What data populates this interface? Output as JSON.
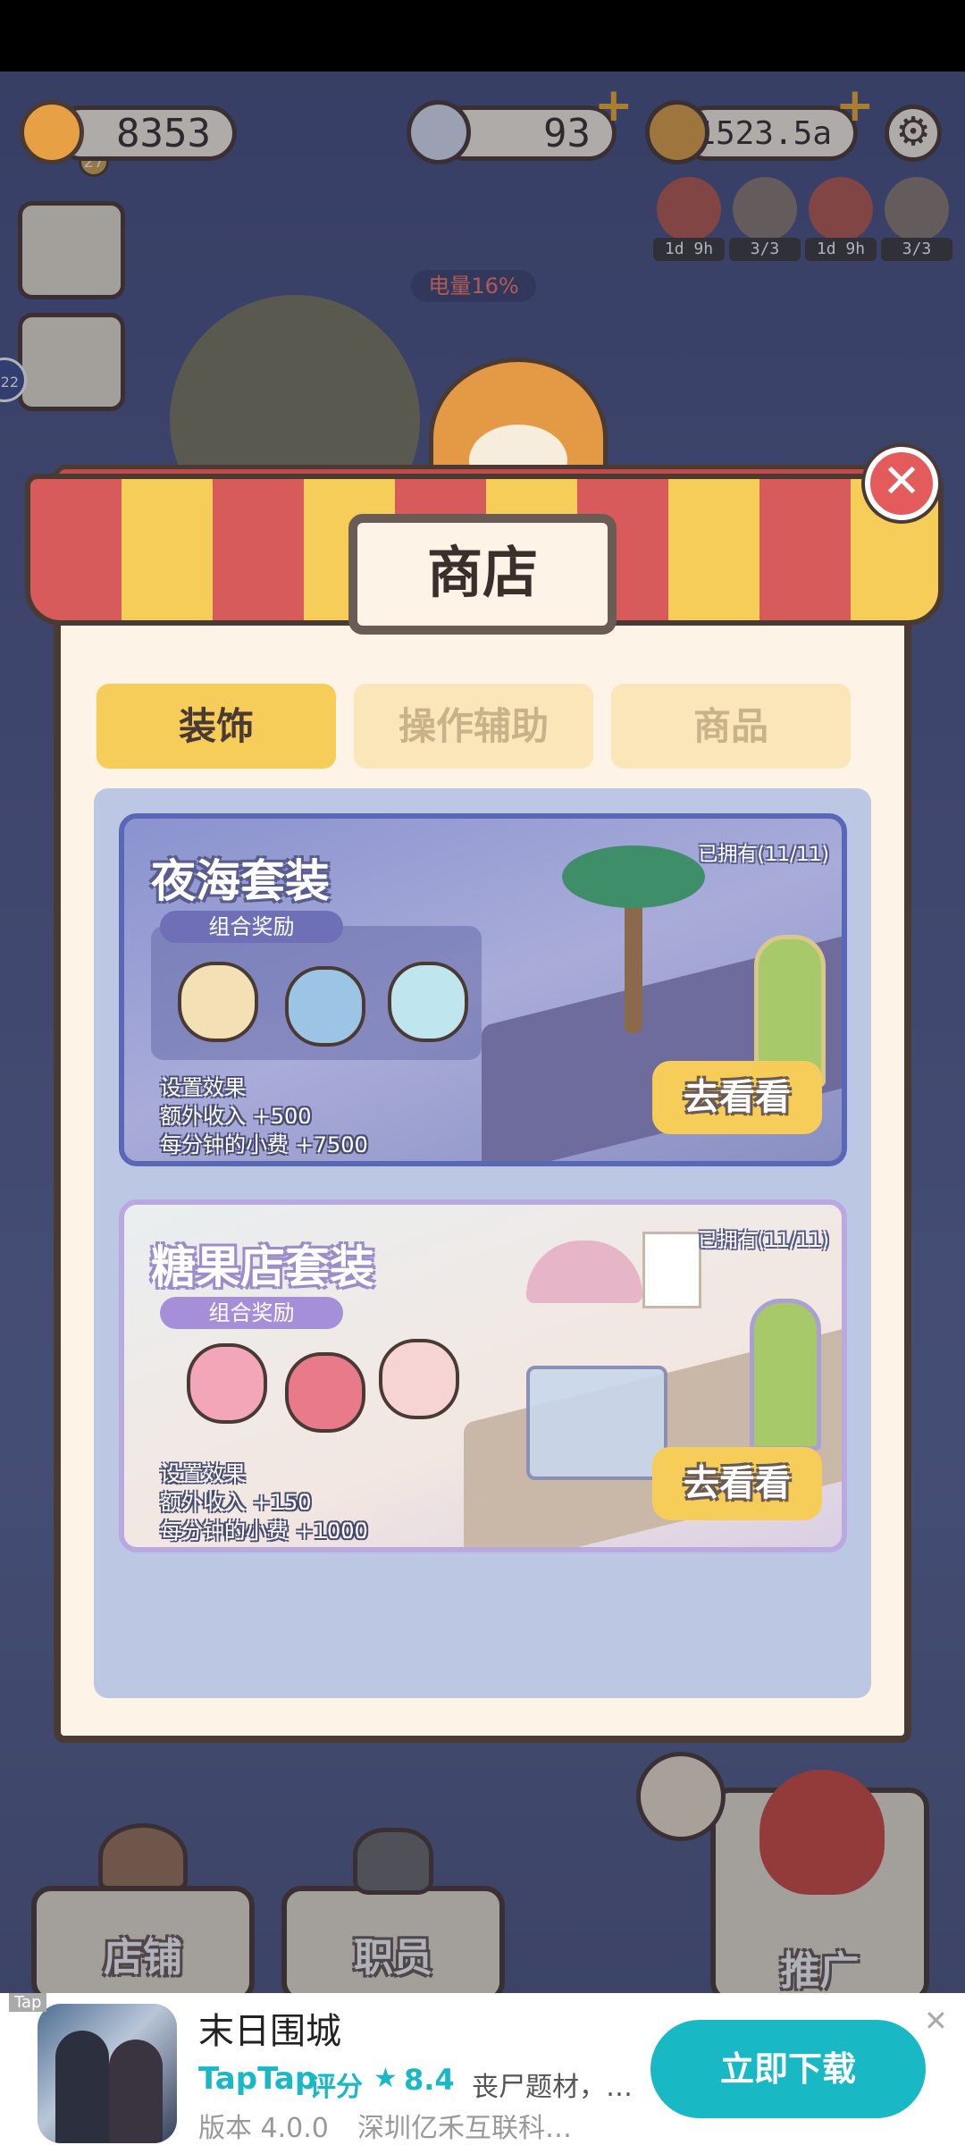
{
  "hud": {
    "bread_count": "8353",
    "bread_level": "27",
    "diamonds": "93",
    "coins": "1523.5a",
    "battery": "电量16%",
    "timers": [
      "1d 9h",
      "3/3",
      "1d 9h",
      "3/3"
    ],
    "side_badge": "22"
  },
  "shop": {
    "title": "商店",
    "tabs": [
      "装饰",
      "操作辅助",
      "商品"
    ],
    "active_tab": "装饰",
    "cards": [
      {
        "title": "夜海套装",
        "owned": "已拥有(11/11)",
        "combo_label": "组合奖励",
        "effect_title": "设置效果",
        "effect_income": "额外收入  +500",
        "effect_tips": "每分钟的小费  +7500",
        "button": "去看看"
      },
      {
        "title": "糖果店套装",
        "owned": "已拥有(11/11)",
        "combo_label": "组合奖励",
        "effect_title": "设置效果",
        "effect_income": "额外收入  +150",
        "effect_tips": "每分钟的小费  +1000",
        "button": "去看看"
      }
    ]
  },
  "bottom_nav": {
    "store": "店铺",
    "staff": "职员",
    "promote": "推广"
  },
  "ad": {
    "tag": "Tap",
    "title": "末日围城",
    "brand": "TapTap",
    "score_label": "评分",
    "star": "★",
    "score": "8.4",
    "tags": "丧尸题材，…",
    "version": "版本 4.0.0",
    "developer": "深圳亿禾互联科…",
    "download": "立即下载",
    "close": "✕"
  },
  "colors": {
    "accent_yellow": "#f7cd5a",
    "awning_red": "#d75b5b",
    "taptap": "#18b9c5",
    "close_red": "#e35b5b"
  }
}
